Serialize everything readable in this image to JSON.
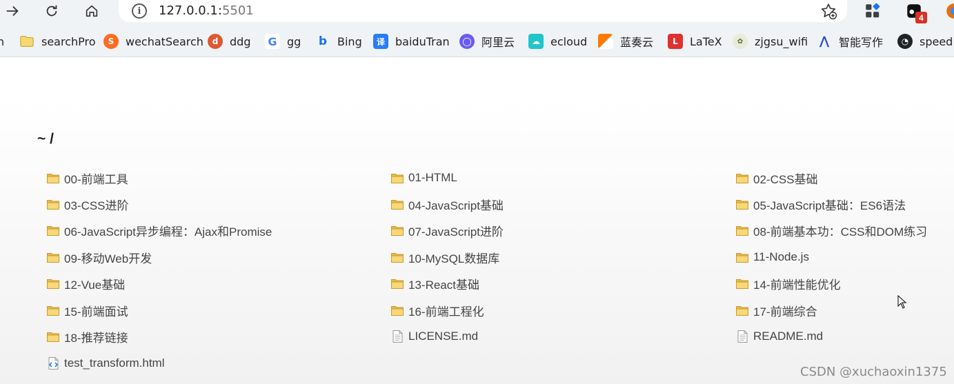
{
  "browser": {
    "url_host": "127.0.0.1:",
    "url_port": "5501",
    "extension_badge": "4"
  },
  "bookmarks": [
    {
      "label": "n",
      "icon": "none"
    },
    {
      "label": "searchPro",
      "icon": "folder-icon"
    },
    {
      "label": "wechatSearch",
      "icon": "sogou-icon"
    },
    {
      "label": "ddg",
      "icon": "duckduckgo-icon"
    },
    {
      "label": "gg",
      "icon": "google-icon"
    },
    {
      "label": "Bing",
      "icon": "bing-icon"
    },
    {
      "label": "baiduTran",
      "icon": "translate-icon"
    },
    {
      "label": "阿里云",
      "icon": "aliyun-icon"
    },
    {
      "label": "ecloud",
      "icon": "cloud-icon"
    },
    {
      "label": "蓝奏云",
      "icon": "lanzou-icon"
    },
    {
      "label": "LaTeX",
      "icon": "latex-icon"
    },
    {
      "label": "zjgsu_wifi",
      "icon": "university-seal-icon"
    },
    {
      "label": "智能写作",
      "icon": "writing-icon"
    },
    {
      "label": "speed",
      "icon": "speedometer-icon"
    }
  ],
  "page": {
    "breadcrumb": "~ /",
    "watermark": "CSDN @xuchaoxin1375"
  },
  "files": [
    {
      "name": "00-前端工具",
      "type": "folder"
    },
    {
      "name": "01-HTML",
      "type": "folder"
    },
    {
      "name": "02-CSS基础",
      "type": "folder"
    },
    {
      "name": "03-CSS进阶",
      "type": "folder"
    },
    {
      "name": "04-JavaScript基础",
      "type": "folder"
    },
    {
      "name": "05-JavaScript基础：ES6语法",
      "type": "folder"
    },
    {
      "name": "06-JavaScript异步编程：Ajax和Promise",
      "type": "folder"
    },
    {
      "name": "07-JavaScript进阶",
      "type": "folder"
    },
    {
      "name": "08-前端基本功：CSS和DOM练习",
      "type": "folder"
    },
    {
      "name": "09-移动Web开发",
      "type": "folder"
    },
    {
      "name": "10-MySQL数据库",
      "type": "folder"
    },
    {
      "name": "11-Node.js",
      "type": "folder"
    },
    {
      "name": "12-Vue基础",
      "type": "folder"
    },
    {
      "name": "13-React基础",
      "type": "folder"
    },
    {
      "name": "14-前端性能优化",
      "type": "folder"
    },
    {
      "name": "15-前端面试",
      "type": "folder"
    },
    {
      "name": "16-前端工程化",
      "type": "folder"
    },
    {
      "name": "17-前端综合",
      "type": "folder"
    },
    {
      "name": "18-推荐链接",
      "type": "folder"
    },
    {
      "name": "LICENSE.md",
      "type": "text"
    },
    {
      "name": "README.md",
      "type": "text"
    },
    {
      "name": "test_transform.html",
      "type": "html"
    }
  ]
}
